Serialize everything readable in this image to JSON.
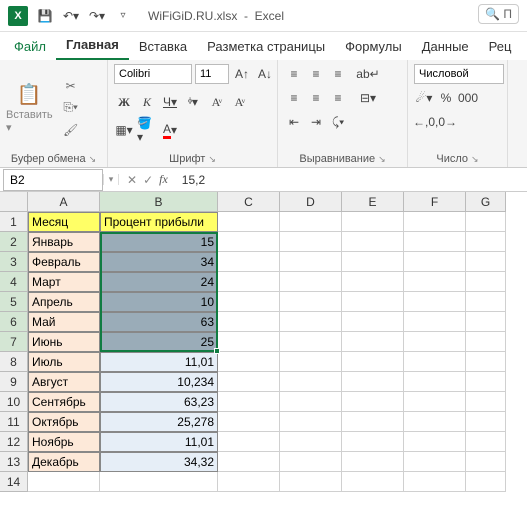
{
  "titlebar": {
    "filename": "WiFiGiD.RU.xlsx",
    "appname": "Excel",
    "search_placeholder": "П"
  },
  "menu": {
    "file": "Файл",
    "home": "Главная",
    "insert": "Вставка",
    "pagelayout": "Разметка страницы",
    "formulas": "Формулы",
    "data": "Данные",
    "review": "Рец"
  },
  "ribbon": {
    "paste_label": "Вставить",
    "clipboard_label": "Буфер обмена",
    "font_name": "Colibri",
    "font_size": "11",
    "font_label": "Шрифт",
    "align_label": "Выравнивание",
    "number_format": "Числовой",
    "number_label": "Число"
  },
  "namebox": {
    "ref": "B2",
    "formula": "15,2"
  },
  "columns": [
    "A",
    "B",
    "C",
    "D",
    "E",
    "F",
    "G"
  ],
  "sheet": {
    "header_month": "Месяц",
    "header_profit": "Процент прибыли",
    "rows": [
      {
        "month": "Январь",
        "value": "15"
      },
      {
        "month": "Февраль",
        "value": "34"
      },
      {
        "month": "Март",
        "value": "24"
      },
      {
        "month": "Апрель",
        "value": "10"
      },
      {
        "month": "Май",
        "value": "63"
      },
      {
        "month": "Июнь",
        "value": "25"
      },
      {
        "month": "Июль",
        "value": "11,01"
      },
      {
        "month": "Август",
        "value": "10,234"
      },
      {
        "month": "Сентябрь",
        "value": "63,23"
      },
      {
        "month": "Октябрь",
        "value": "25,278"
      },
      {
        "month": "Ноябрь",
        "value": "11,01"
      },
      {
        "month": "Декабрь",
        "value": "34,32"
      }
    ]
  }
}
